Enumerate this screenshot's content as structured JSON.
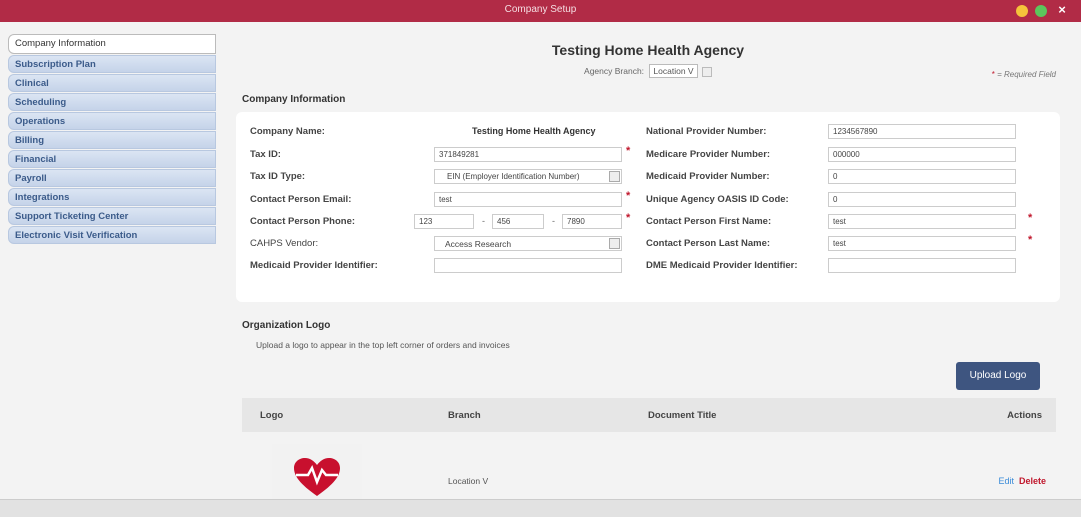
{
  "window": {
    "title": "Company Setup"
  },
  "sidebar": {
    "items": [
      {
        "label": "Company Information",
        "active": true
      },
      {
        "label": "Subscription Plan"
      },
      {
        "label": "Clinical"
      },
      {
        "label": "Scheduling"
      },
      {
        "label": "Operations"
      },
      {
        "label": "Billing"
      },
      {
        "label": "Financial"
      },
      {
        "label": "Payroll"
      },
      {
        "label": "Integrations"
      },
      {
        "label": "Support Ticketing Center"
      },
      {
        "label": "Electronic Visit Verification"
      }
    ]
  },
  "header": {
    "agency_name": "Testing Home Health Agency",
    "branch_label": "Agency Branch:",
    "branch_value": "Location V",
    "required_note_star": "*",
    "required_note_text": " = Required Field"
  },
  "company_info": {
    "section_title": "Company Information",
    "company_name_label": "Company Name:",
    "company_name_value": "Testing Home Health Agency",
    "tax_id_label": "Tax ID:",
    "tax_id_value": "371849281",
    "tax_id_type_label": "Tax ID Type:",
    "tax_id_type_value": "EIN (Employer Identification Number)",
    "contact_email_label": "Contact Person Email:",
    "contact_email_value": "test",
    "contact_phone_label": "Contact Person Phone:",
    "phone_part1": "123",
    "phone_part2": "456",
    "phone_part3": "7890",
    "phone_dash": "-",
    "cahps_label": "CAHPS Vendor:",
    "cahps_value": "Access Research",
    "medicaid_identifier_label": "Medicaid Provider Identifier:",
    "medicaid_identifier_value": "",
    "npi_label": "National Provider Number:",
    "npi_value": "1234567890",
    "medicare_label": "Medicare Provider Number:",
    "medicare_value": "000000",
    "medicaid_number_label": "Medicaid Provider Number:",
    "medicaid_number_value": "0",
    "oasis_label": "Unique Agency OASIS ID Code:",
    "oasis_value": "0",
    "first_name_label": "Contact Person First Name:",
    "first_name_value": "test",
    "last_name_label": "Contact Person Last Name:",
    "last_name_value": "test",
    "dme_label": "DME Medicaid Provider Identifier:",
    "dme_value": "",
    "required_star": "*"
  },
  "org_logo": {
    "section_title": "Organization Logo",
    "note": "Upload a logo to appear in the top left corner of orders and invoices",
    "upload_button": "Upload Logo",
    "columns": [
      "Logo",
      "Branch",
      "Document Title",
      "Actions"
    ],
    "rows": [
      {
        "branch": "Location V",
        "document_title": "",
        "edit": "Edit",
        "delete": "Delete"
      }
    ]
  },
  "colors": {
    "titlebar": "#b12b46",
    "required": "#c0172c",
    "upload_button": "#3e5580",
    "edit_link": "#3a8bd8",
    "delete_link": "#c0172c",
    "logo_icon": "#c8102e"
  },
  "icons": {
    "logo": "heart-pulse-icon",
    "close": "close-icon",
    "minimize": "minimize-icon",
    "maximize": "maximize-icon"
  }
}
